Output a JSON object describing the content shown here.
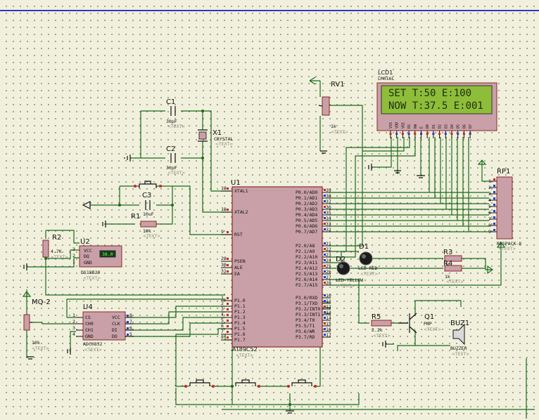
{
  "components": {
    "lcd": {
      "ref": "LCD1",
      "part": "LM016L",
      "line1": "SET T:50    E:100",
      "line2": "NOW T:37.5 E:001",
      "pins": [
        "VSS",
        "VDD",
        "VEE",
        "RS",
        "RW",
        "E",
        "D0",
        "D1",
        "D2",
        "D3",
        "D4",
        "D5",
        "D6",
        "D7"
      ]
    },
    "rv1": {
      "ref": "RV1",
      "value": "1k"
    },
    "c1": {
      "ref": "C1",
      "value": "30pF"
    },
    "c2": {
      "ref": "C2",
      "value": "30pF"
    },
    "x1": {
      "ref": "X1",
      "value": "CRYSTAL"
    },
    "c3": {
      "ref": "C3",
      "value": "10uF"
    },
    "r1": {
      "ref": "R1",
      "value": "10k"
    },
    "r2": {
      "ref": "R2",
      "value": "4.7K"
    },
    "u2": {
      "ref": "U2",
      "part": "DS18B20",
      "pins": [
        "VCC",
        "DQ",
        "GND"
      ],
      "pin_nums": [
        "3",
        "2",
        "1"
      ],
      "display": "38.0"
    },
    "mq2": {
      "ref": "MQ-2",
      "value": "10k"
    },
    "u4": {
      "ref": "U4",
      "part": "ADC0832",
      "pins_left": [
        "CS",
        "CH0",
        "CH1",
        "GND"
      ],
      "pins_right": [
        "VCC",
        "CLK",
        "DI",
        "DO"
      ],
      "nums_left": [
        "1",
        "2",
        "3",
        "4"
      ],
      "nums_right": [
        "8",
        "7",
        "6",
        "5"
      ]
    },
    "u1": {
      "ref": "U1",
      "part": "AT89C52",
      "left_pins": [
        {
          "num": "19",
          "name": "XTAL1"
        },
        {
          "num": "18",
          "name": "XTAL2"
        },
        {
          "num": "9",
          "name": "RST"
        },
        {
          "num": "29",
          "name": "PSEN"
        },
        {
          "num": "30",
          "name": "ALE"
        },
        {
          "num": "31",
          "name": "EA"
        },
        {
          "num": "1",
          "name": "P1.0"
        },
        {
          "num": "2",
          "name": "P1.1"
        },
        {
          "num": "3",
          "name": "P1.2"
        },
        {
          "num": "4",
          "name": "P1.3"
        },
        {
          "num": "5",
          "name": "P1.4"
        },
        {
          "num": "6",
          "name": "P1.5"
        },
        {
          "num": "7",
          "name": "P1.6"
        },
        {
          "num": "8",
          "name": "P1.7"
        }
      ],
      "right_pins": [
        {
          "num": "39",
          "name": "P0.0/AD0"
        },
        {
          "num": "38",
          "name": "P0.1/AD1"
        },
        {
          "num": "37",
          "name": "P0.2/AD2"
        },
        {
          "num": "36",
          "name": "P0.3/AD3"
        },
        {
          "num": "35",
          "name": "P0.4/AD4"
        },
        {
          "num": "34",
          "name": "P0.5/AD5"
        },
        {
          "num": "33",
          "name": "P0.6/AD6"
        },
        {
          "num": "32",
          "name": "P0.7/AD7"
        },
        {
          "num": "21",
          "name": "P2.0/A8"
        },
        {
          "num": "22",
          "name": "P2.1/A9"
        },
        {
          "num": "23",
          "name": "P2.2/A10"
        },
        {
          "num": "24",
          "name": "P2.3/A11"
        },
        {
          "num": "25",
          "name": "P2.4/A12"
        },
        {
          "num": "26",
          "name": "P2.5/A13"
        },
        {
          "num": "27",
          "name": "P2.6/A14"
        },
        {
          "num": "28",
          "name": "P2.7/A15"
        },
        {
          "num": "10",
          "name": "P3.0/RXD"
        },
        {
          "num": "11",
          "name": "P3.1/TXD"
        },
        {
          "num": "12",
          "name": "P3.2/INT0"
        },
        {
          "num": "13",
          "name": "P3.3/INT1"
        },
        {
          "num": "14",
          "name": "P3.4/T0"
        },
        {
          "num": "15",
          "name": "P3.5/T1"
        },
        {
          "num": "16",
          "name": "P3.6/WR"
        },
        {
          "num": "17",
          "name": "P3.7/RD"
        }
      ]
    },
    "rp1": {
      "ref": "RP1",
      "part": "RESPACK-8",
      "pins": [
        "1",
        "2",
        "3",
        "4",
        "5",
        "6",
        "7",
        "8",
        "9"
      ]
    },
    "d1": {
      "ref": "D1",
      "part": "LED-RED"
    },
    "d2": {
      "ref": "D2",
      "part": "LED-YELLOW"
    },
    "r3": {
      "ref": "R3",
      "value": "1k"
    },
    "r4": {
      "ref": "R4",
      "value": "1k"
    },
    "r5": {
      "ref": "R5",
      "value": "2.2k"
    },
    "q1": {
      "ref": "Q1",
      "part": "PNP"
    },
    "buz1": {
      "ref": "BUZ1",
      "part": "BUZZER"
    }
  },
  "text_placeholder": "<TEXT>",
  "colors": {
    "wire": "#1a6a1a",
    "body": "#c9a0a8",
    "lcd_bg": "#8ebd3a",
    "frame": "#2f36c8",
    "pin_dot_red": "#d12121",
    "pin_dot_blue": "#2838d8"
  }
}
